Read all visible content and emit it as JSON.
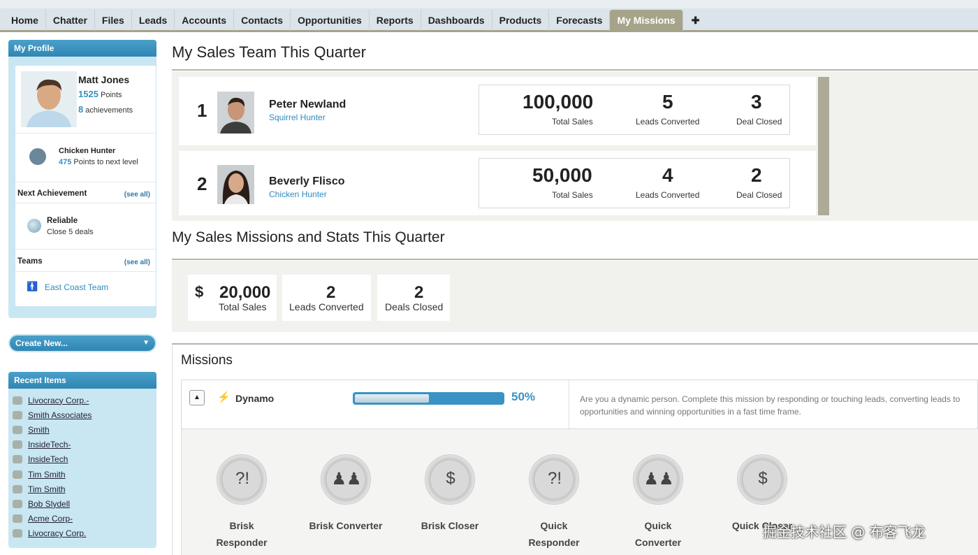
{
  "tabs": [
    "Home",
    "Chatter",
    "Files",
    "Leads",
    "Accounts",
    "Contacts",
    "Opportunities",
    "Reports",
    "Dashboards",
    "Products",
    "Forecasts",
    "My Missions",
    "✚"
  ],
  "active_tab": "My Missions",
  "profile": {
    "header": "My Profile",
    "name": "Matt Jones",
    "points_value": "1525",
    "points_label": "Points",
    "achievements_value": "8",
    "achievements_label": "achievements",
    "level_name": "Chicken Hunter",
    "level_points": "475",
    "level_points_label": "Points to next level",
    "next_achievement_label": "Next Achievement",
    "see_all": "(see all)",
    "achievement_name": "Reliable",
    "achievement_desc": "Close 5 deals",
    "teams_label": "Teams",
    "team_name": "East Coast Team"
  },
  "create_new": "Create New...",
  "recent": {
    "header": "Recent Items",
    "items": [
      "Livocracy Corp.-",
      "Smith Associates",
      "Smith",
      "InsideTech-",
      "InsideTech",
      "Tim Smith",
      "Tim Smith",
      "Bob Slydell",
      "Acme Corp-",
      "Livocracy Corp."
    ]
  },
  "sales_team": {
    "title": "My Sales Team This Quarter",
    "members": [
      {
        "rank": "1",
        "name": "Peter Newland",
        "title": "Squirrel Hunter",
        "total_sales": "100,000",
        "leads_converted": "5",
        "deals_closed": "3"
      },
      {
        "rank": "2",
        "name": "Beverly Flisco",
        "title": "Chicken Hunter",
        "total_sales": "50,000",
        "leads_converted": "4",
        "deals_closed": "2"
      }
    ],
    "labels": {
      "total_sales": "Total Sales",
      "leads_converted": "Leads Converted",
      "deals_closed": "Deal Closed"
    }
  },
  "my_stats": {
    "title": "My Sales Missions and Stats This Quarter",
    "currency": "$",
    "total_sales": "20,000",
    "total_sales_label": "Total Sales",
    "leads_converted": "2",
    "leads_converted_label": "Leads Converted",
    "deals_closed": "2",
    "deals_closed_label": "Deals Closed"
  },
  "missions": {
    "title": "Missions",
    "mission": {
      "name": "Dynamo",
      "progress_percent": 50,
      "progress_label": "50%",
      "description": "Are you a dynamic person. Complete this mission by responding or touching leads, converting leads to opportunities and winning opportunities in a fast time frame."
    },
    "badges": [
      {
        "line1": "Brisk",
        "line2": "Responder",
        "icon": "question-chat-icon"
      },
      {
        "line1": "Brisk Converter",
        "line2": "",
        "icon": "people-icon"
      },
      {
        "line1": "Brisk Closer",
        "line2": "",
        "icon": "piggy-bank-icon"
      },
      {
        "line1": "Quick",
        "line2": "Responder",
        "icon": "question-chat-icon"
      },
      {
        "line1": "Quick",
        "line2": "Converter",
        "icon": "people-icon"
      },
      {
        "line1": "Quick Closer",
        "line2": "",
        "icon": "piggy-bank-icon"
      }
    ]
  },
  "watermark": "掘金技术社区 @ 布客飞龙"
}
